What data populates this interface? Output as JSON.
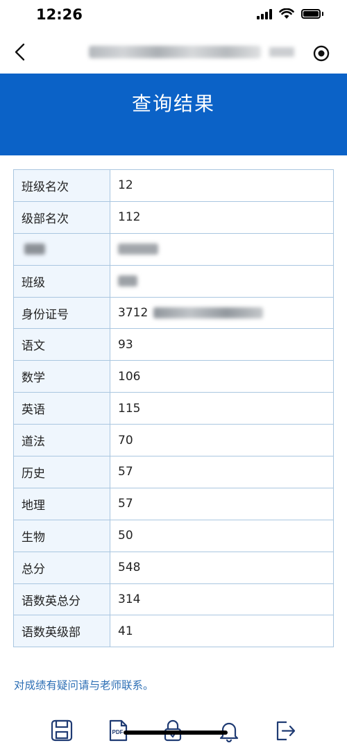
{
  "status_bar": {
    "time": "12:26"
  },
  "header": {
    "title": "查询结果"
  },
  "results": {
    "rows": [
      {
        "label": "班级名次",
        "value": "12"
      },
      {
        "label": "级部名次",
        "value": "112"
      },
      {
        "label": "",
        "value": ""
      },
      {
        "label": "班级",
        "value": ""
      },
      {
        "label": "身份证号",
        "value": "3712"
      },
      {
        "label": "语文",
        "value": "93"
      },
      {
        "label": "数学",
        "value": "106"
      },
      {
        "label": "英语",
        "value": "115"
      },
      {
        "label": "道法",
        "value": "70"
      },
      {
        "label": "历史",
        "value": "57"
      },
      {
        "label": "地理",
        "value": "57"
      },
      {
        "label": "生物",
        "value": "50"
      },
      {
        "label": "总分",
        "value": "548"
      },
      {
        "label": "语数英总分",
        "value": "314"
      },
      {
        "label": "语数英级部",
        "value": "41"
      }
    ]
  },
  "footer_note": "对成绩有疑问请与老师联系。",
  "icons": {
    "back": "chevron-left-icon",
    "target": "target-icon",
    "save": "save-icon",
    "pdf": "pdf-icon",
    "lock": "lock-icon",
    "bell": "bell-icon",
    "logout": "logout-icon"
  },
  "colors": {
    "header_bg": "#0b62c7",
    "label_bg": "#eff6fd",
    "border": "#a9c6e0",
    "note_text": "#2d6fb5"
  }
}
